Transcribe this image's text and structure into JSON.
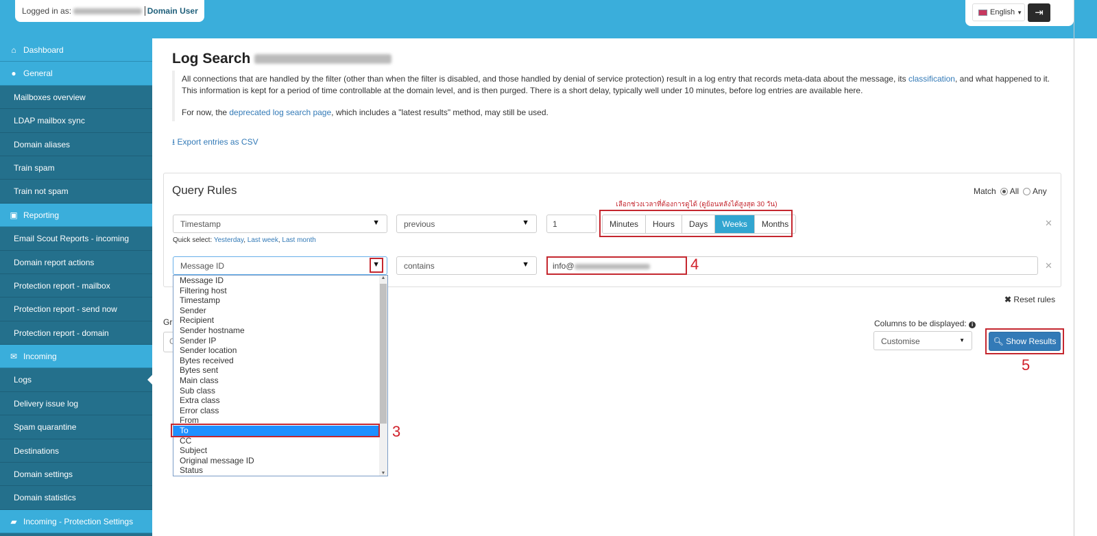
{
  "header": {
    "logged_in_label": "Logged in as:",
    "role": "Domain User",
    "language": "English",
    "logout_icon": "logout-icon"
  },
  "sidebar": {
    "items": [
      {
        "label": "Dashboard",
        "type": "header",
        "icon": "home-icon"
      },
      {
        "label": "General",
        "type": "header",
        "icon": "globe-icon"
      },
      {
        "label": "Mailboxes overview"
      },
      {
        "label": "LDAP mailbox sync"
      },
      {
        "label": "Domain aliases"
      },
      {
        "label": "Train spam"
      },
      {
        "label": "Train not spam"
      },
      {
        "label": "Reporting",
        "type": "header",
        "icon": "inbox-icon"
      },
      {
        "label": "Email Scout Reports - incoming"
      },
      {
        "label": "Domain report actions"
      },
      {
        "label": "Protection report - mailbox"
      },
      {
        "label": "Protection report - send now"
      },
      {
        "label": "Protection report - domain"
      },
      {
        "label": "Incoming",
        "type": "header",
        "icon": "envelope-icon"
      },
      {
        "label": "Logs",
        "selected": true
      },
      {
        "label": "Delivery issue log"
      },
      {
        "label": "Spam quarantine"
      },
      {
        "label": "Destinations"
      },
      {
        "label": "Domain settings"
      },
      {
        "label": "Domain statistics"
      },
      {
        "label": "Incoming - Protection Settings",
        "type": "header",
        "icon": "folder-open-icon"
      }
    ]
  },
  "main": {
    "title": "Log Search",
    "desc1_a": "All connections that are handled by the filter (other than when the filter is disabled, and those handled by denial of service protection) result in a log entry that records meta-data about the message, its ",
    "desc1_link": "classification",
    "desc1_b": ", and what happened to it. This information is kept for a period of time controllable at the domain level, and is then purged. There is a short delay, typically well under 10 minutes, before log entries are available here.",
    "desc2_a": "For now, the ",
    "desc2_link": "deprecated log search page",
    "desc2_b": ", which includes a \"latest results\" method, may still be used.",
    "export_label": "Export entries as CSV",
    "query": {
      "title": "Query Rules",
      "match_label": "Match",
      "match_all": "All",
      "match_any": "Any",
      "match_selected": "All",
      "annotation_thai": "เลือกช่วงเวลาที่ต้องการดูได้ (ดูย้อนหลังได้สูงสุด 30 วัน)",
      "row1": {
        "field": "Timestamp",
        "operator": "previous",
        "value": "1",
        "units": [
          "Minutes",
          "Hours",
          "Days",
          "Weeks",
          "Months"
        ],
        "active_unit": "Weeks"
      },
      "quick_label": "Quick select:",
      "quick_links": [
        "Yesterday",
        "Last week",
        "Last month"
      ],
      "row2": {
        "field": "Message ID",
        "operator": "contains",
        "value": "info@"
      },
      "dropdown_options": [
        "Message ID",
        "Filtering host",
        "Timestamp",
        "Sender",
        "Recipient",
        "Sender hostname",
        "Sender IP",
        "Sender location",
        "Bytes received",
        "Bytes sent",
        "Main class",
        "Sub class",
        "Extra class",
        "Error class",
        "From",
        "To",
        "CC",
        "Subject",
        "Original message ID",
        "Status"
      ],
      "highlighted_option": "To"
    },
    "reset_label": "Reset rules",
    "group_label_partial": "Gr",
    "group_value_partial": "C",
    "columns_label": "Columns to be displayed:",
    "columns_value": "Customise",
    "show_results_label": "Show Results",
    "annotations": [
      "3",
      "4",
      "5"
    ]
  },
  "colors": {
    "topbar": "#3aaedb",
    "sidebar": "#24708c",
    "primary": "#337ab7",
    "annotation": "#c4262e",
    "active_unit": "#31a5d0"
  }
}
